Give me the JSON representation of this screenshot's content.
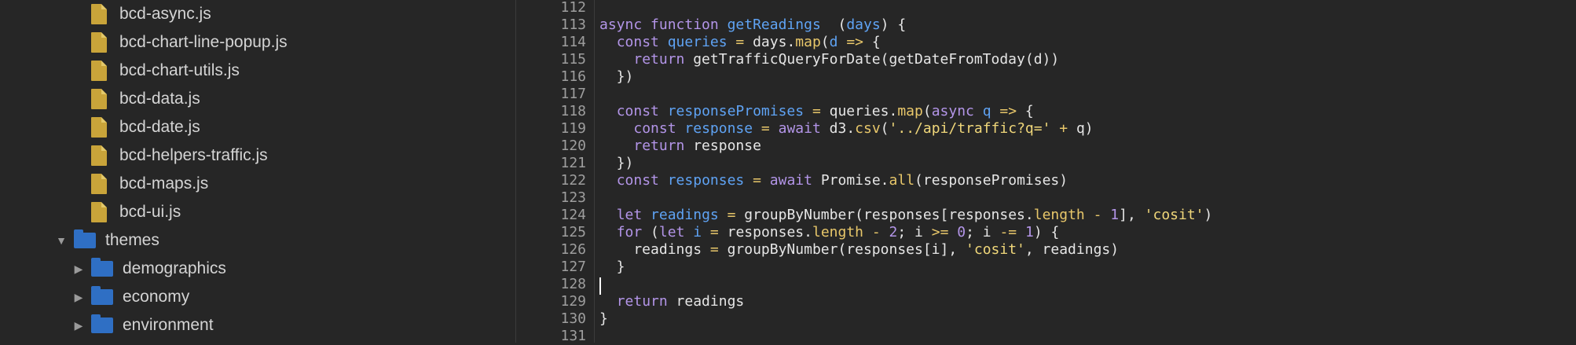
{
  "sidebar": {
    "files": [
      {
        "label": "bcd-async.js"
      },
      {
        "label": "bcd-chart-line-popup.js"
      },
      {
        "label": "bcd-chart-utils.js"
      },
      {
        "label": "bcd-data.js"
      },
      {
        "label": "bcd-date.js"
      },
      {
        "label": "bcd-helpers-traffic.js"
      },
      {
        "label": "bcd-maps.js"
      },
      {
        "label": "bcd-ui.js"
      }
    ],
    "folder_open": {
      "label": "themes"
    },
    "subfolders": [
      {
        "label": "demographics"
      },
      {
        "label": "economy"
      },
      {
        "label": "environment"
      }
    ],
    "icons": {
      "file": "js-file-icon",
      "folder": "folder-icon",
      "expanded": "chevron-down-icon",
      "collapsed": "chevron-right-icon"
    }
  },
  "editor": {
    "line_numbers": [
      "112",
      "113",
      "114",
      "115",
      "116",
      "117",
      "118",
      "119",
      "120",
      "121",
      "122",
      "123",
      "124",
      "125",
      "126",
      "127",
      "128",
      "129",
      "130",
      "131"
    ],
    "lines": [
      [],
      [
        [
          "kw",
          "async "
        ],
        [
          "kw",
          "function "
        ],
        [
          "fn",
          "getReadings"
        ],
        [
          "",
          "  ("
        ],
        [
          "vr",
          "days"
        ],
        [
          "",
          ") {"
        ]
      ],
      [
        [
          "",
          "  "
        ],
        [
          "kw",
          "const "
        ],
        [
          "vr",
          "queries"
        ],
        [
          "op",
          " = "
        ],
        [
          "",
          "days."
        ],
        [
          "prop",
          "map"
        ],
        [
          "",
          "("
        ],
        [
          "vr",
          "d"
        ],
        [
          "op",
          " => "
        ],
        [
          "",
          "{"
        ]
      ],
      [
        [
          "",
          "    "
        ],
        [
          "kw",
          "return "
        ],
        [
          "",
          "getTrafficQueryForDate(getDateFromToday(d))"
        ]
      ],
      [
        [
          "",
          "  })"
        ]
      ],
      [],
      [
        [
          "",
          "  "
        ],
        [
          "kw",
          "const "
        ],
        [
          "vr",
          "responsePromises"
        ],
        [
          "op",
          " = "
        ],
        [
          "",
          "queries."
        ],
        [
          "prop",
          "map"
        ],
        [
          "",
          "("
        ],
        [
          "kw",
          "async "
        ],
        [
          "vr",
          "q"
        ],
        [
          "op",
          " => "
        ],
        [
          "",
          "{"
        ]
      ],
      [
        [
          "",
          "    "
        ],
        [
          "kw",
          "const "
        ],
        [
          "vr",
          "response"
        ],
        [
          "op",
          " = "
        ],
        [
          "kw",
          "await "
        ],
        [
          "",
          "d3."
        ],
        [
          "prop",
          "csv"
        ],
        [
          "",
          "("
        ],
        [
          "str",
          "'../api/traffic?q='"
        ],
        [
          "op",
          " + "
        ],
        [
          "",
          "q)"
        ]
      ],
      [
        [
          "",
          "    "
        ],
        [
          "kw",
          "return "
        ],
        [
          "",
          "response"
        ]
      ],
      [
        [
          "",
          "  })"
        ]
      ],
      [
        [
          "",
          "  "
        ],
        [
          "kw",
          "const "
        ],
        [
          "vr",
          "responses"
        ],
        [
          "op",
          " = "
        ],
        [
          "kw",
          "await "
        ],
        [
          "",
          "Promise."
        ],
        [
          "prop",
          "all"
        ],
        [
          "",
          "(responsePromises)"
        ]
      ],
      [],
      [
        [
          "",
          "  "
        ],
        [
          "kw",
          "let "
        ],
        [
          "vr",
          "readings"
        ],
        [
          "op",
          " = "
        ],
        [
          "",
          "groupByNumber(responses[responses."
        ],
        [
          "prop",
          "length"
        ],
        [
          "op",
          " - "
        ],
        [
          "num",
          "1"
        ],
        [
          "",
          "], "
        ],
        [
          "str",
          "'cosit'"
        ],
        [
          "",
          ")"
        ]
      ],
      [
        [
          "",
          "  "
        ],
        [
          "kw",
          "for "
        ],
        [
          "",
          "("
        ],
        [
          "kw",
          "let "
        ],
        [
          "vr",
          "i"
        ],
        [
          "op",
          " = "
        ],
        [
          "",
          "responses."
        ],
        [
          "prop",
          "length"
        ],
        [
          "op",
          " - "
        ],
        [
          "num",
          "2"
        ],
        [
          "",
          "; i "
        ],
        [
          "op",
          ">="
        ],
        [
          "num",
          " 0"
        ],
        [
          "",
          "; i "
        ],
        [
          "op",
          "-="
        ],
        [
          "num",
          " 1"
        ],
        [
          "",
          ") {"
        ]
      ],
      [
        [
          "",
          "    readings "
        ],
        [
          "op",
          "= "
        ],
        [
          "",
          "groupByNumber(responses[i], "
        ],
        [
          "str",
          "'cosit'"
        ],
        [
          "",
          ", readings)"
        ]
      ],
      [
        [
          "",
          "  }"
        ]
      ],
      [],
      [
        [
          "",
          "  "
        ],
        [
          "kw",
          "return "
        ],
        [
          "",
          "readings"
        ]
      ],
      [
        [
          "",
          "}"
        ]
      ],
      []
    ]
  }
}
